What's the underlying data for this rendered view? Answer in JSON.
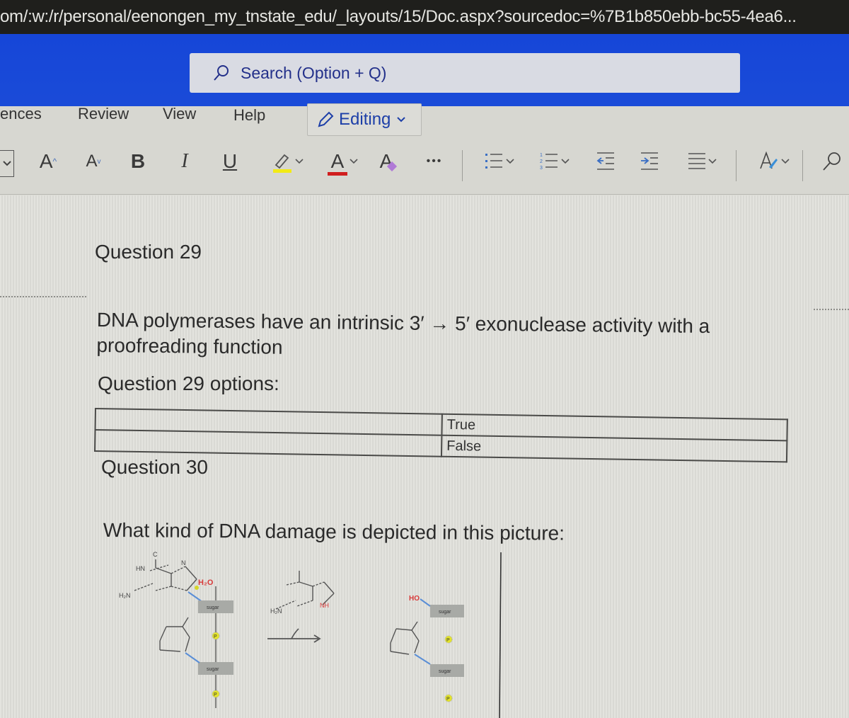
{
  "browser": {
    "url": "om/:w:/r/personal/eenongen_my_tnstate_edu/_layouts/15/Doc.aspx?sourcedoc=%7B1b850ebb-bc55-4ea6..."
  },
  "header": {
    "search_placeholder": "Search (Option + Q)",
    "brand_color": "#1a4bd8"
  },
  "ribbon": {
    "tabs": [
      {
        "label": "ences"
      },
      {
        "label": "Review"
      },
      {
        "label": "View"
      },
      {
        "label": "Help"
      }
    ],
    "editing_label": "Editing",
    "tools": {
      "grow_font": "A",
      "shrink_font": "A",
      "bold": "B",
      "italic": "I",
      "underline": "U",
      "font_color": "A",
      "clear_format": "A",
      "more": "•••"
    },
    "highlight_color": "#f2ea16",
    "font_color_value": "#d01e1e"
  },
  "document": {
    "q29": {
      "heading": "Question 29",
      "text": "DNA polymerases have an intrinsic 3′ → 5′ exonuclease activity with a proofreading function",
      "options_label": "Question 29 options:",
      "options": [
        "True",
        "False"
      ]
    },
    "q30": {
      "heading": "Question 30",
      "text": "What kind of DNA damage is depicted in this picture:"
    },
    "figure": {
      "labels": {
        "c_top": "C",
        "hn": "HN",
        "n1": "N",
        "n2": "N",
        "h2n": "H₂N",
        "h2o": "H₂O",
        "sugar": "sugar",
        "p": "P",
        "ho": "HO",
        "nh": "NH"
      }
    }
  }
}
